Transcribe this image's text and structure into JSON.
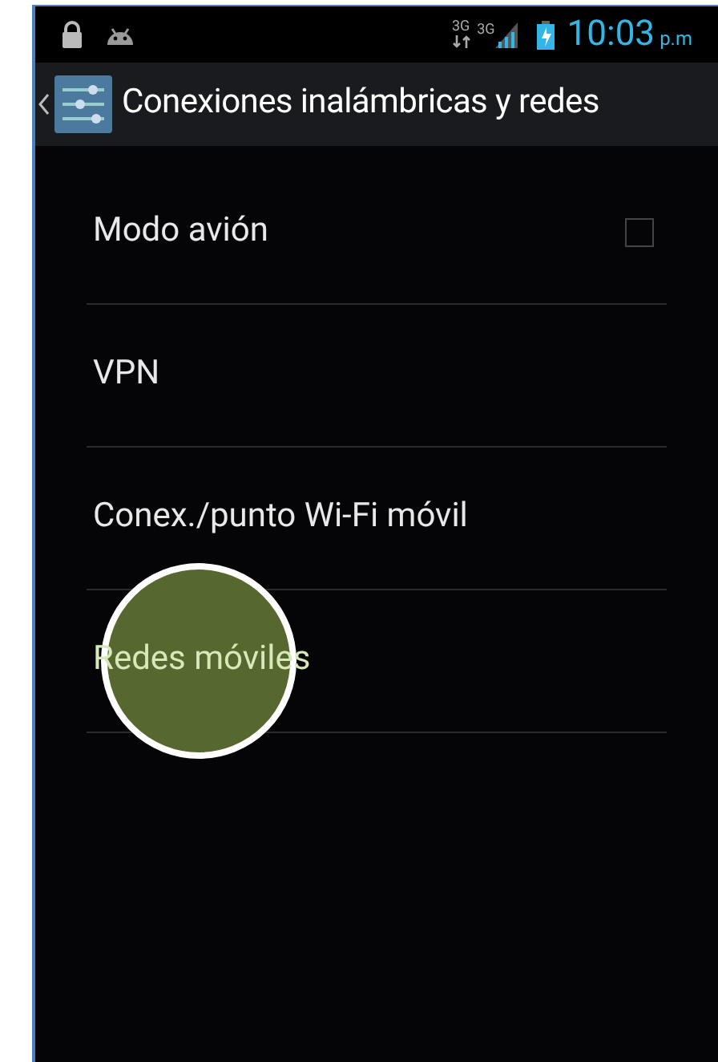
{
  "status_bar": {
    "data_type": "3G",
    "signal_type": "3G",
    "time": "10:03",
    "ampm": "p.m"
  },
  "action_bar": {
    "title": "Conexiones inalámbricas y redes"
  },
  "settings": [
    {
      "kind": "checkbox",
      "label": "Modo avión",
      "checked": false
    },
    {
      "kind": "plain",
      "label": "VPN"
    },
    {
      "kind": "plain",
      "label": "Conex./punto Wi-Fi móvil"
    },
    {
      "kind": "plain",
      "label": "Redes móviles",
      "touched": true
    }
  ]
}
